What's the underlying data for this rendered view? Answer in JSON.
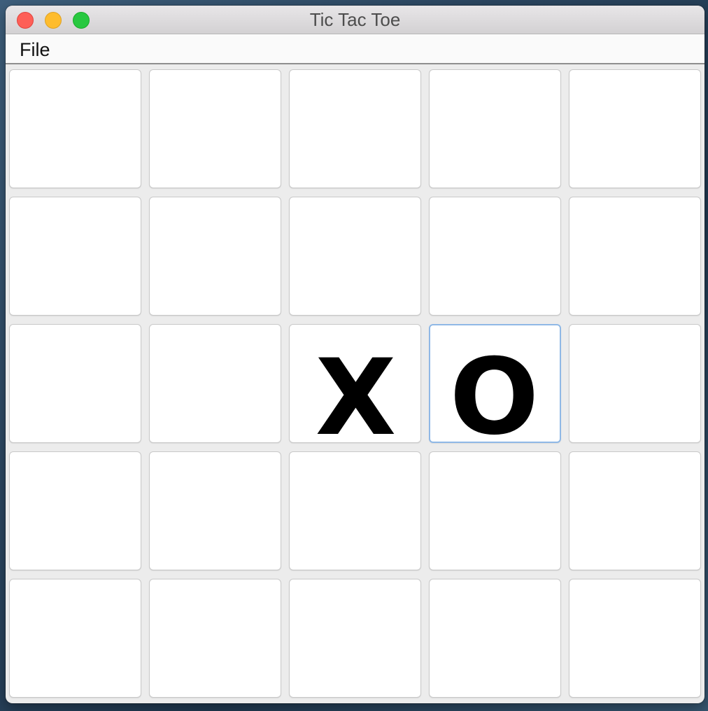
{
  "window": {
    "title": "Tic Tac Toe"
  },
  "menu": {
    "file": "File"
  },
  "board": {
    "rows": 5,
    "cols": 5,
    "focused_cell": [
      2,
      3
    ],
    "cells": [
      [
        "",
        "",
        "",
        "",
        ""
      ],
      [
        "",
        "",
        "",
        "",
        ""
      ],
      [
        "",
        "",
        "X",
        "O",
        ""
      ],
      [
        "",
        "",
        "",
        "",
        ""
      ],
      [
        "",
        "",
        "",
        "",
        ""
      ]
    ]
  }
}
